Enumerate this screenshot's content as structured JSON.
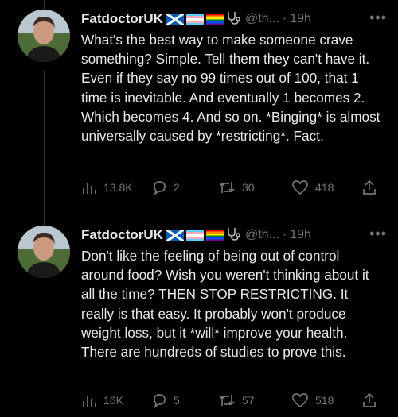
{
  "tweets": [
    {
      "name": "FatdoctorUK",
      "handle": "@th...",
      "sep": "·",
      "time": "19h",
      "more": "•••",
      "text": "What's the best way to make someone crave something? Simple. Tell them they can't have it. Even if they say no 99 times out of 100, that 1 time is inevitable. And eventually 1 becomes 2. Which becomes 4. And so on. *Binging* is almost universally caused by *restricting*. Fact.",
      "views": "13.8K",
      "replies": "2",
      "retweets": "30",
      "likes": "418"
    },
    {
      "name": "FatdoctorUK",
      "handle": "@th...",
      "sep": "·",
      "time": "19h",
      "more": "•••",
      "text": "Don't like the feeling of being out of control around food? Wish you weren't thinking about it all the time? THEN STOP RESTRICTING. It really is that easy. It probably won't produce weight loss, but it *will* improve your health. There are hundreds of studies to prove this.",
      "views": "16K",
      "replies": "5",
      "retweets": "57",
      "likes": "518"
    }
  ],
  "colors": {
    "background": "#000000",
    "text": "#e7e9ea",
    "muted": "#71767b"
  },
  "icons": [
    "scotland-flag-icon",
    "trans-flag-icon",
    "pride-flag-icon",
    "stethoscope-icon",
    "views-icon",
    "reply-icon",
    "retweet-icon",
    "like-icon",
    "share-icon"
  ]
}
